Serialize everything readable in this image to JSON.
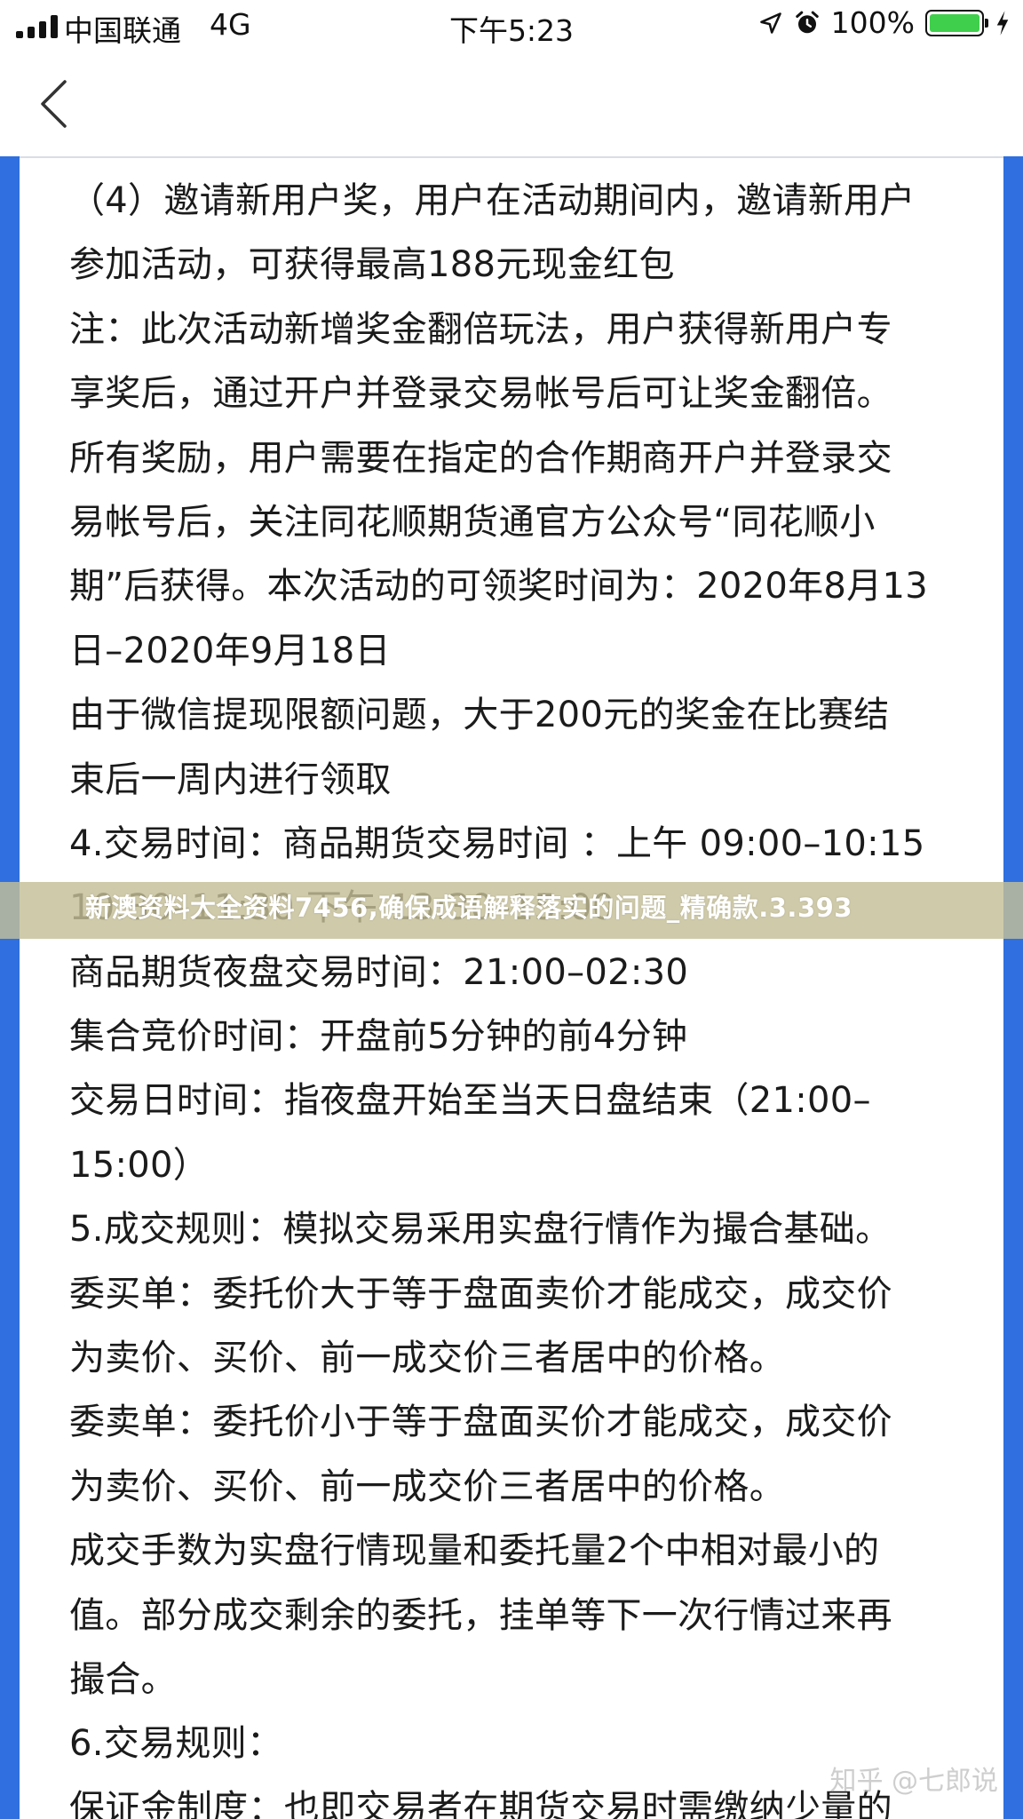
{
  "status_bar": {
    "carrier": "中国联通",
    "network": "4G",
    "time": "下午5:23",
    "battery": "100%",
    "battery_level": 1.0,
    "battery_color": "#3fcf4c"
  },
  "nav": {
    "back_icon": "chevron-left-icon"
  },
  "document": {
    "lines": [
      "（4）邀请新用户奖，用户在活动期间内，邀请新用户",
      "参加活动，可获得最高188元现金红包",
      "注：此次活动新增奖金翻倍玩法，用户获得新用户专",
      "享奖后，通过开户并登录交易帐号后可让奖金翻倍。",
      "所有奖励，用户需要在指定的合作期商开户并登录交",
      "易帐号后，关注同花顺期货通官方公众号“同花顺小",
      "期”后获得。本次活动的可领奖时间为：2020年8月13",
      "日–2020年9月18日",
      "由于微信提现限额问题，大于200元的奖金在比赛结",
      "束后一周内进行领取",
      "4.交易时间：商品期货交易时间 ：上午 09:00–10:15",
      "10:30–11:30 下午 13:30–15:00",
      "商品期货夜盘交易时间：21:00–02:30",
      "集合竞价时间：开盘前5分钟的前4分钟",
      "交易日时间：指夜盘开始至当天日盘结束（21:00–",
      "15:00）",
      "5.成交规则：模拟交易采用实盘行情作为撮合基础。",
      "委买单：委托价大于等于盘面卖价才能成交，成交价",
      "为卖价、买价、前一成交价三者居中的价格。",
      "委卖单：委托价小于等于盘面买价才能成交，成交价",
      "为卖价、买价、前一成交价三者居中的价格。",
      "成交手数为实盘行情现量和委托量2个中相对最小的",
      "值。部分成交剩余的委托，挂单等下一次行情过来再",
      "撮合。",
      "6.交易规则：",
      "保证金制度：也即交易者在期货交易时需缴纳少量的"
    ]
  },
  "banner": {
    "text": "新澳资料大全资料7456,确保成语解释落实的问题_精确款.3.393"
  },
  "watermark": {
    "text": "知乎 @七郎说"
  },
  "colors": {
    "frame_blue": "#2f6fe0"
  }
}
